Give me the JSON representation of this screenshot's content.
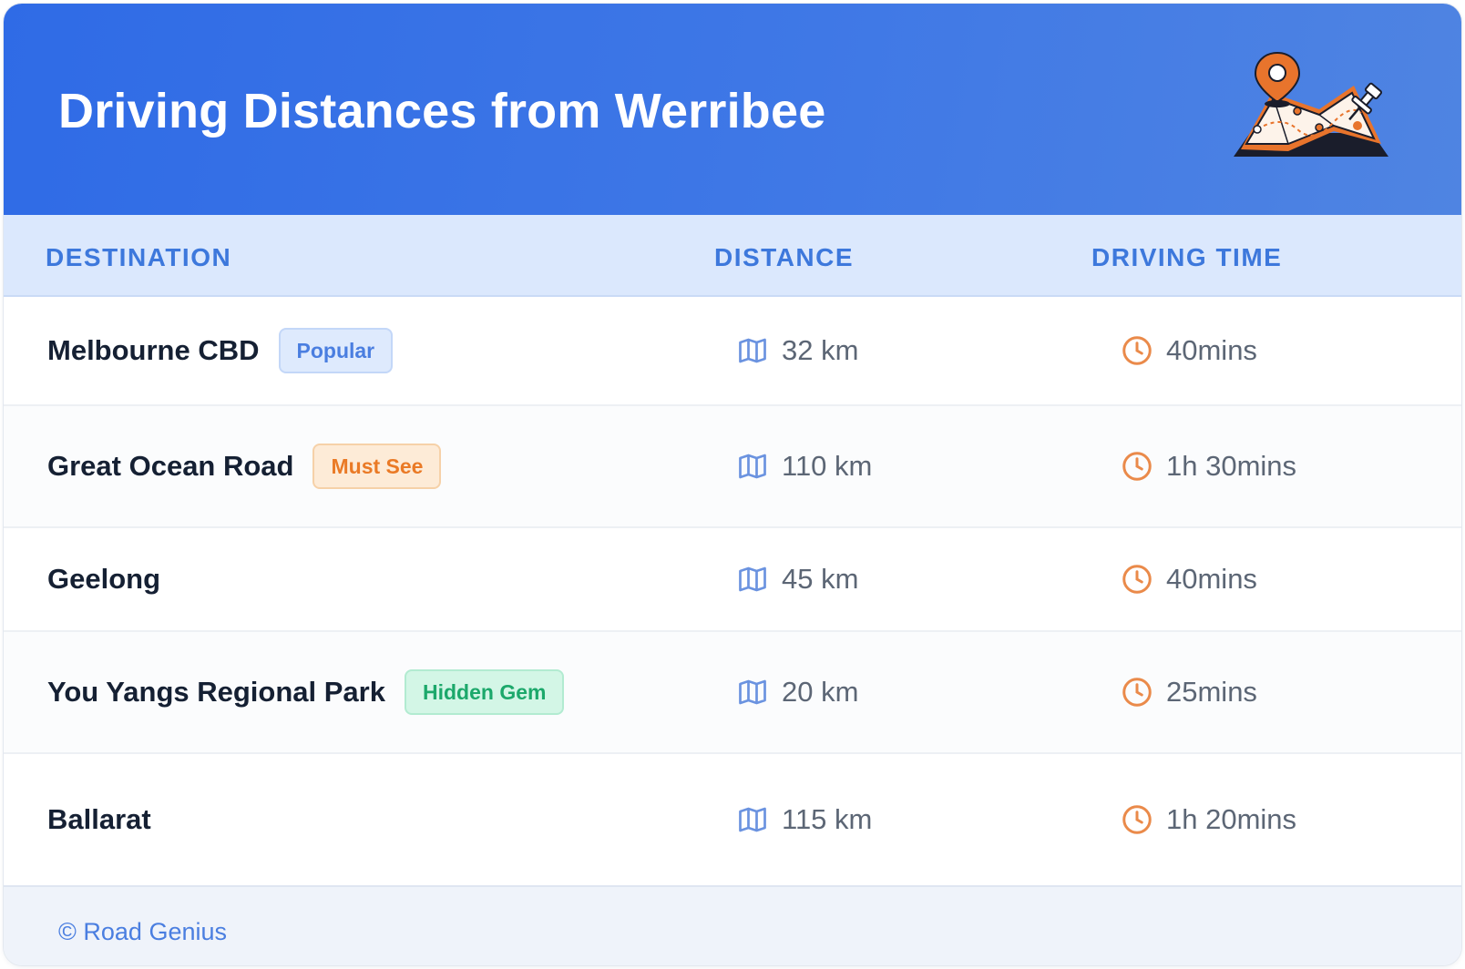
{
  "header": {
    "title": "Driving Distances from Werribee",
    "illustration": "map-with-pins-icon",
    "gradient_colors": [
      "#2f6be6",
      "#4f84e2"
    ]
  },
  "columns": {
    "destination": "DESTINATION",
    "distance": "DISTANCE",
    "time": "DRIVING TIME"
  },
  "rows": [
    {
      "destination": "Melbourne CBD",
      "badge": "Popular",
      "badge_color": "#4a7ee0",
      "distance": "32 km",
      "time": "40mins"
    },
    {
      "destination": "Great Ocean Road",
      "badge": "Must See",
      "badge_color": "#ea7a26",
      "distance": "110 km",
      "time": "1h 30mins"
    },
    {
      "destination": "Geelong",
      "badge": null,
      "distance": "45 km",
      "time": "40mins"
    },
    {
      "destination": "You Yangs Regional Park",
      "badge": "Hidden Gem",
      "badge_color": "#1ca86b",
      "distance": "20 km",
      "time": "25mins"
    },
    {
      "destination": "Ballarat",
      "badge": null,
      "distance": "115 km",
      "time": "1h 20mins"
    }
  ],
  "icons": {
    "distance": "map-icon",
    "time": "clock-icon"
  },
  "colors": {
    "accent": "#3d78dc",
    "clock": "#ea8a4a",
    "map": "#6b93e0"
  },
  "footer": {
    "text": "© Road Genius"
  }
}
